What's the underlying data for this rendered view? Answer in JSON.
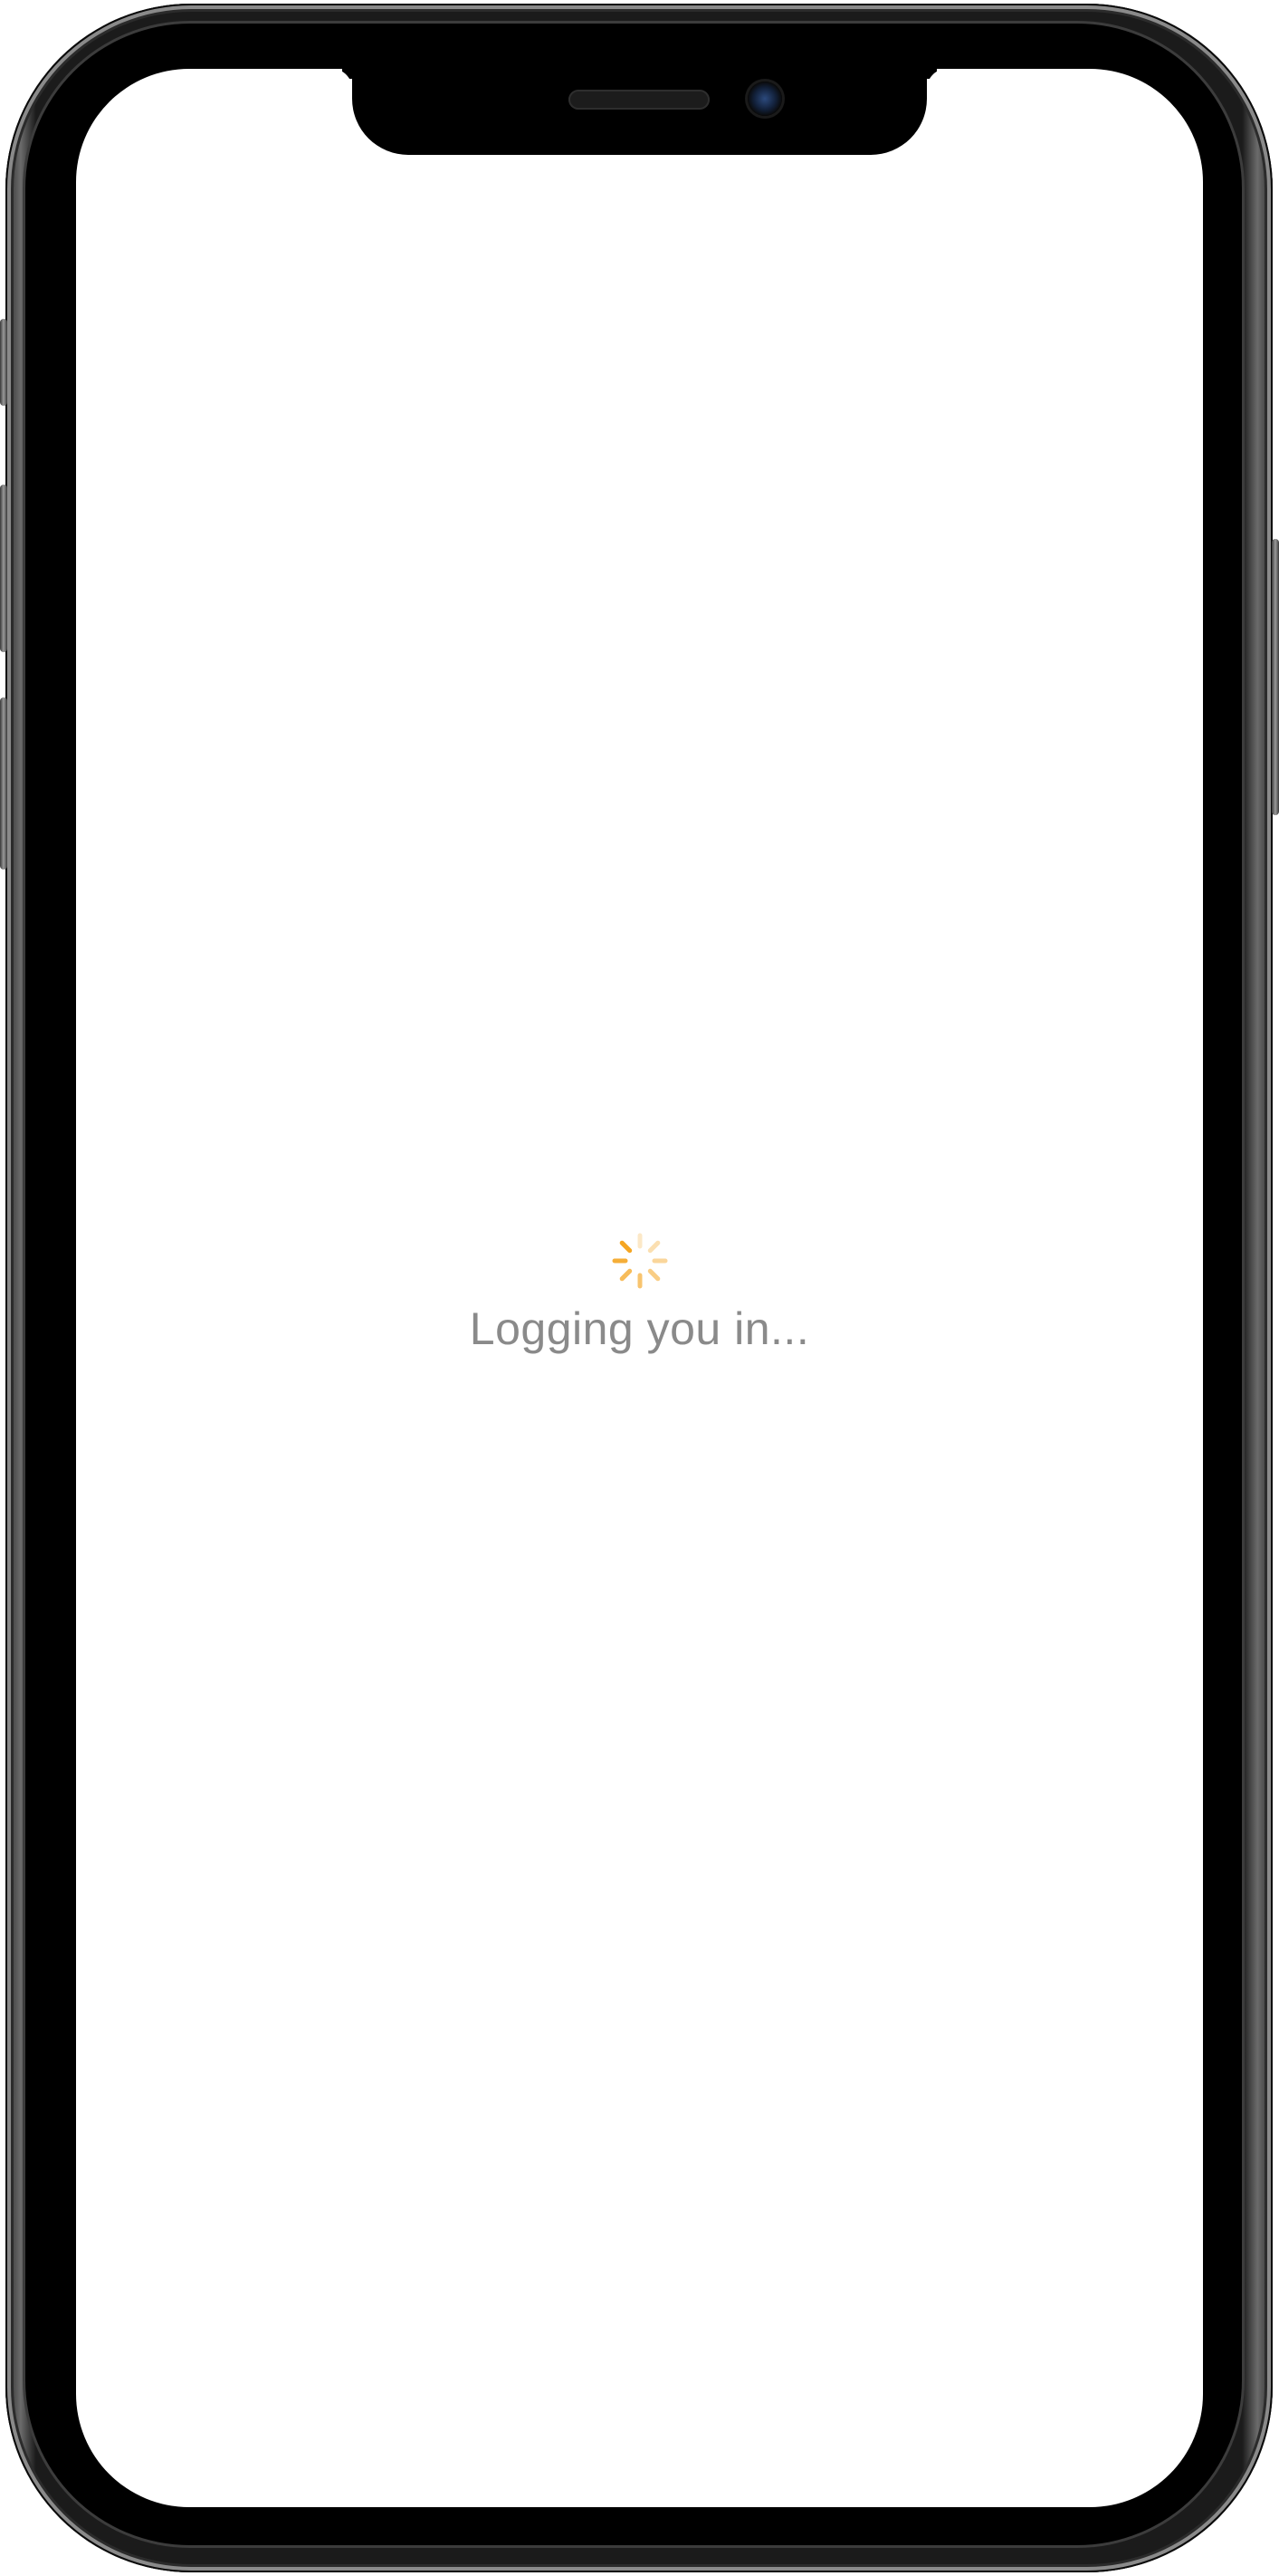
{
  "app": {
    "loading_message": "Logging you in...",
    "spinner_icon": "activity-spinner-icon",
    "accent_color": "#f5a623",
    "text_color": "#8a8a8a"
  }
}
